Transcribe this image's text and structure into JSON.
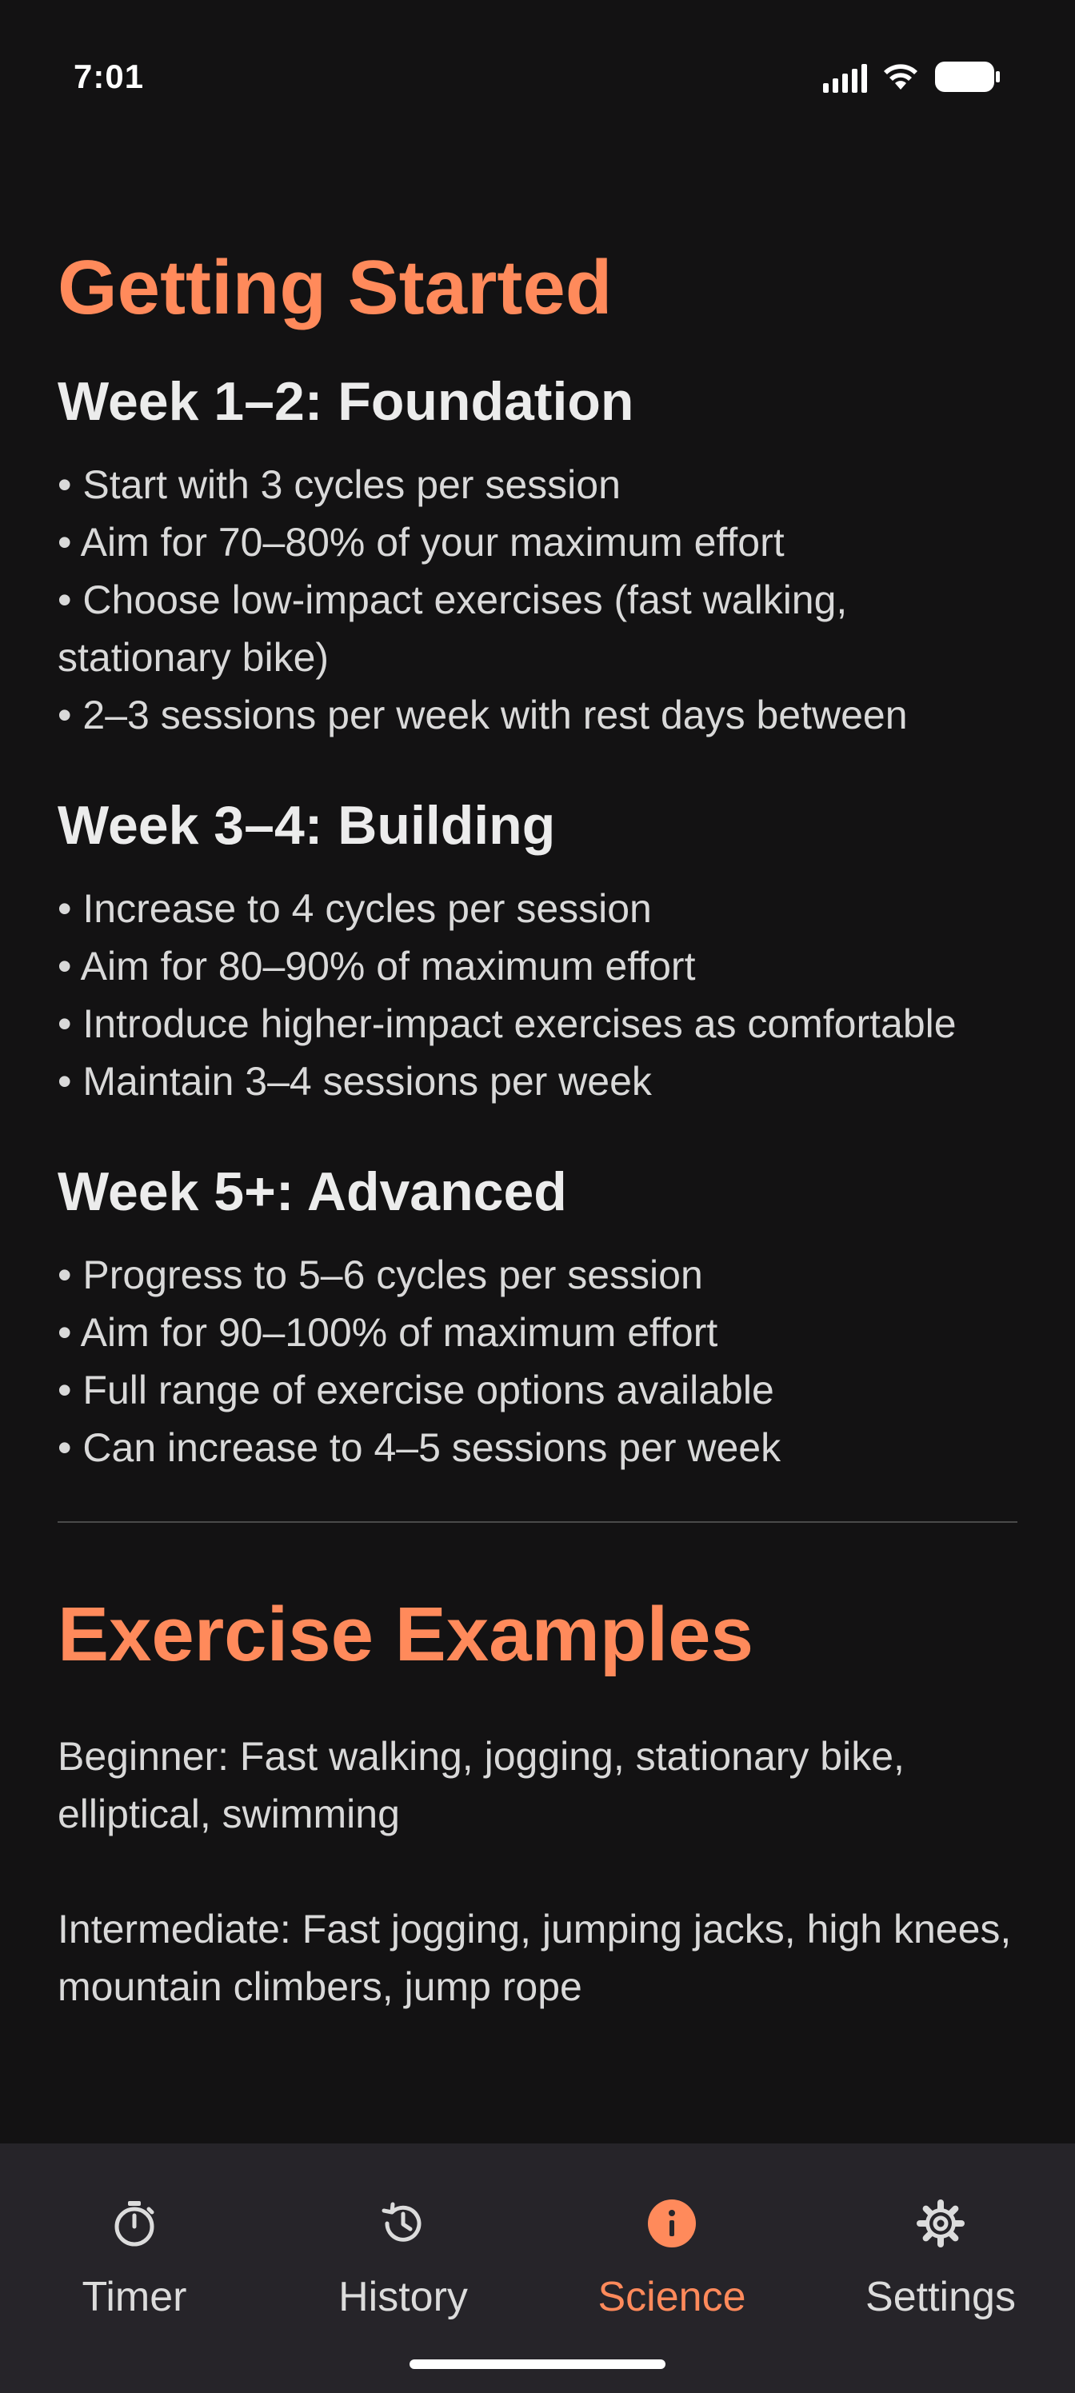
{
  "status_bar": {
    "time": "7:01"
  },
  "getting_started": {
    "title": "Getting Started",
    "weeks": [
      {
        "title": "Week 1–2: Foundation",
        "items": [
          "• Start with 3 cycles per session",
          "• Aim for 70–80% of your maximum effort",
          "• Choose low-impact exercises (fast walking, stationary bike)",
          "• 2–3 sessions per week with rest days between"
        ]
      },
      {
        "title": "Week 3–4: Building",
        "items": [
          "• Increase to 4 cycles per session",
          "• Aim for 80–90% of maximum effort",
          "• Introduce higher-impact exercises as comfortable",
          "• Maintain 3–4 sessions per week"
        ]
      },
      {
        "title": "Week 5+: Advanced",
        "items": [
          "• Progress to 5–6 cycles per session",
          "• Aim for 90–100% of maximum effort",
          "• Full range of exercise options available",
          "• Can increase to 4–5 sessions per week"
        ]
      }
    ]
  },
  "exercise_examples": {
    "title": "Exercise Examples",
    "beginner": "Beginner: Fast walking, jogging, stationary bike, elliptical, swimming",
    "intermediate": "Intermediate: Fast jogging, jumping jacks, high knees, mountain climbers, jump rope"
  },
  "bottom_nav": {
    "items": [
      {
        "label": "Timer",
        "icon": "stopwatch-icon",
        "active": false
      },
      {
        "label": "History",
        "icon": "history-icon",
        "active": false
      },
      {
        "label": "Science",
        "icon": "info-icon",
        "active": true
      },
      {
        "label": "Settings",
        "icon": "gear-icon",
        "active": false
      }
    ]
  },
  "colors": {
    "accent": "#ff8a5b",
    "background": "#131213",
    "nav_background": "#262429"
  }
}
